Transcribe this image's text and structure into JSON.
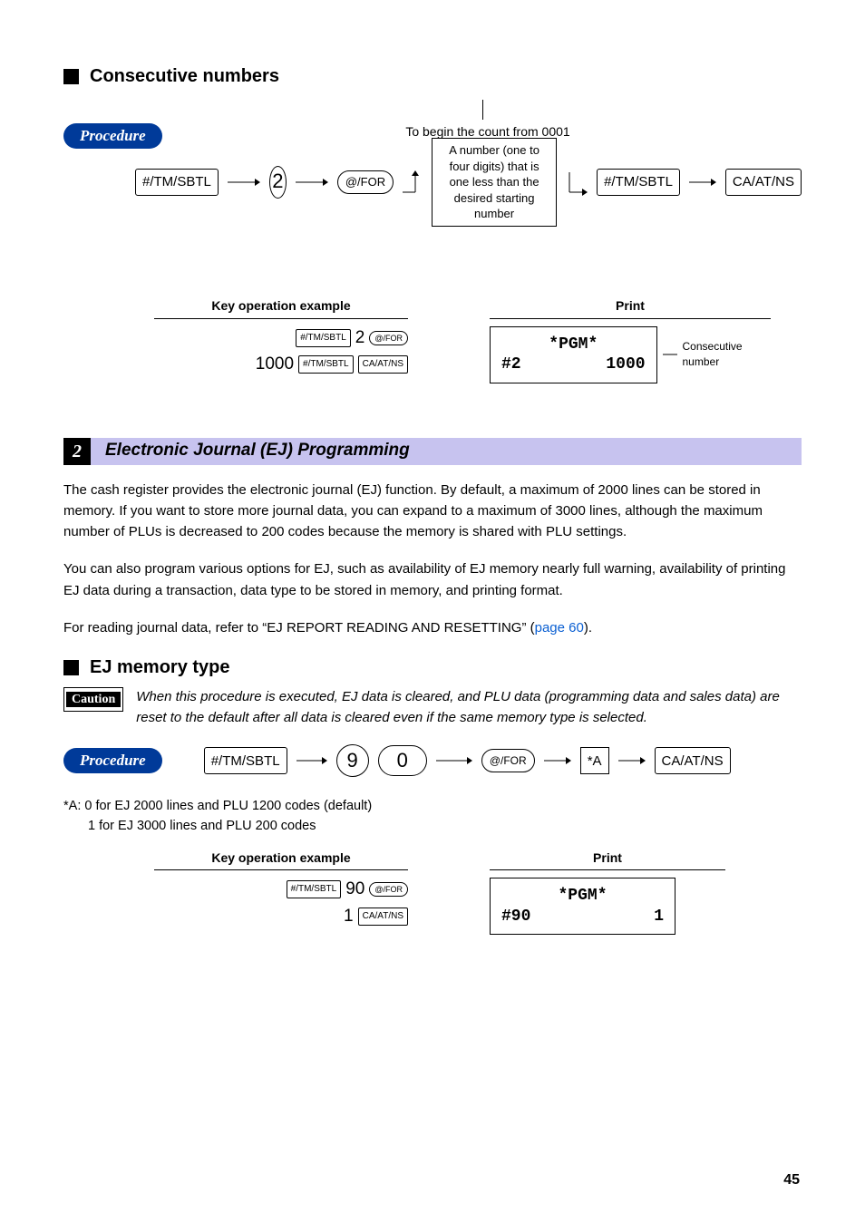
{
  "section1": {
    "heading": "Consecutive numbers",
    "procedure_label": "Procedure",
    "top_note": "To begin the count from 0001",
    "rect_note": "A number (one to four digits) that is one less than the desired starting number",
    "flow": {
      "k1": "#/TM/SBTL",
      "digit": "2",
      "k2": "@/FOR",
      "k3": "#/TM/SBTL",
      "k4": "CA/AT/NS"
    },
    "example_title_left": "Key operation example",
    "example_title_right": "Print",
    "ex_left": {
      "l1_k1": "#/TM/SBTL",
      "l1_d": "2",
      "l1_k2": "@/FOR",
      "l2_d": "1000",
      "l2_k1": "#/TM/SBTL",
      "l2_k2": "CA/AT/NS"
    },
    "ex_right": {
      "line1": "*PGM*",
      "line2_left": "#2",
      "line2_right": "1000",
      "annot": "Consecutive number"
    }
  },
  "band": {
    "num": "2",
    "title": "Electronic Journal (EJ) Programming"
  },
  "para1": "The cash register provides the electronic journal (EJ) function.  By default, a maximum of 2000 lines can be stored in memory.  If you want to store more journal data, you can expand to a maximum of 3000 lines, although the maximum number of PLUs is decreased to 200 codes because the memory is shared with PLU settings.",
  "para2": "You can also program various options for EJ, such as availability of EJ memory nearly full warning, availability of printing EJ data during a transaction, data type to be stored in memory, and printing format.",
  "para3_pre": "For reading journal data, refer to “EJ REPORT READING AND RESETTING” (",
  "para3_link": "page 60",
  "para3_post": ").",
  "section2": {
    "heading": "EJ memory type",
    "caution_label": "Caution",
    "caution_text": "When this procedure is executed, EJ data is cleared, and PLU data (programming data and sales data) are reset to the default after all data is cleared even if the same memory type is selected.",
    "procedure_label": "Procedure",
    "flow": {
      "k1": "#/TM/SBTL",
      "d1": "9",
      "d2": "0",
      "k2": "@/FOR",
      "box": "*A",
      "k3": "CA/AT/NS"
    },
    "footnote_a": "*A: 0 for EJ 2000 lines and PLU 1200 codes (default)",
    "footnote_b": "1 for EJ 3000 lines and PLU 200 codes",
    "example_title_left": "Key operation example",
    "example_title_right": "Print",
    "ex_left": {
      "l1_k1": "#/TM/SBTL",
      "l1_d": "90",
      "l1_k2": "@/FOR",
      "l2_d": "1",
      "l2_k2": "CA/AT/NS"
    },
    "ex_right": {
      "line1": "*PGM*",
      "line2_left": "#90",
      "line2_right": "1"
    }
  },
  "pagenum": "45"
}
